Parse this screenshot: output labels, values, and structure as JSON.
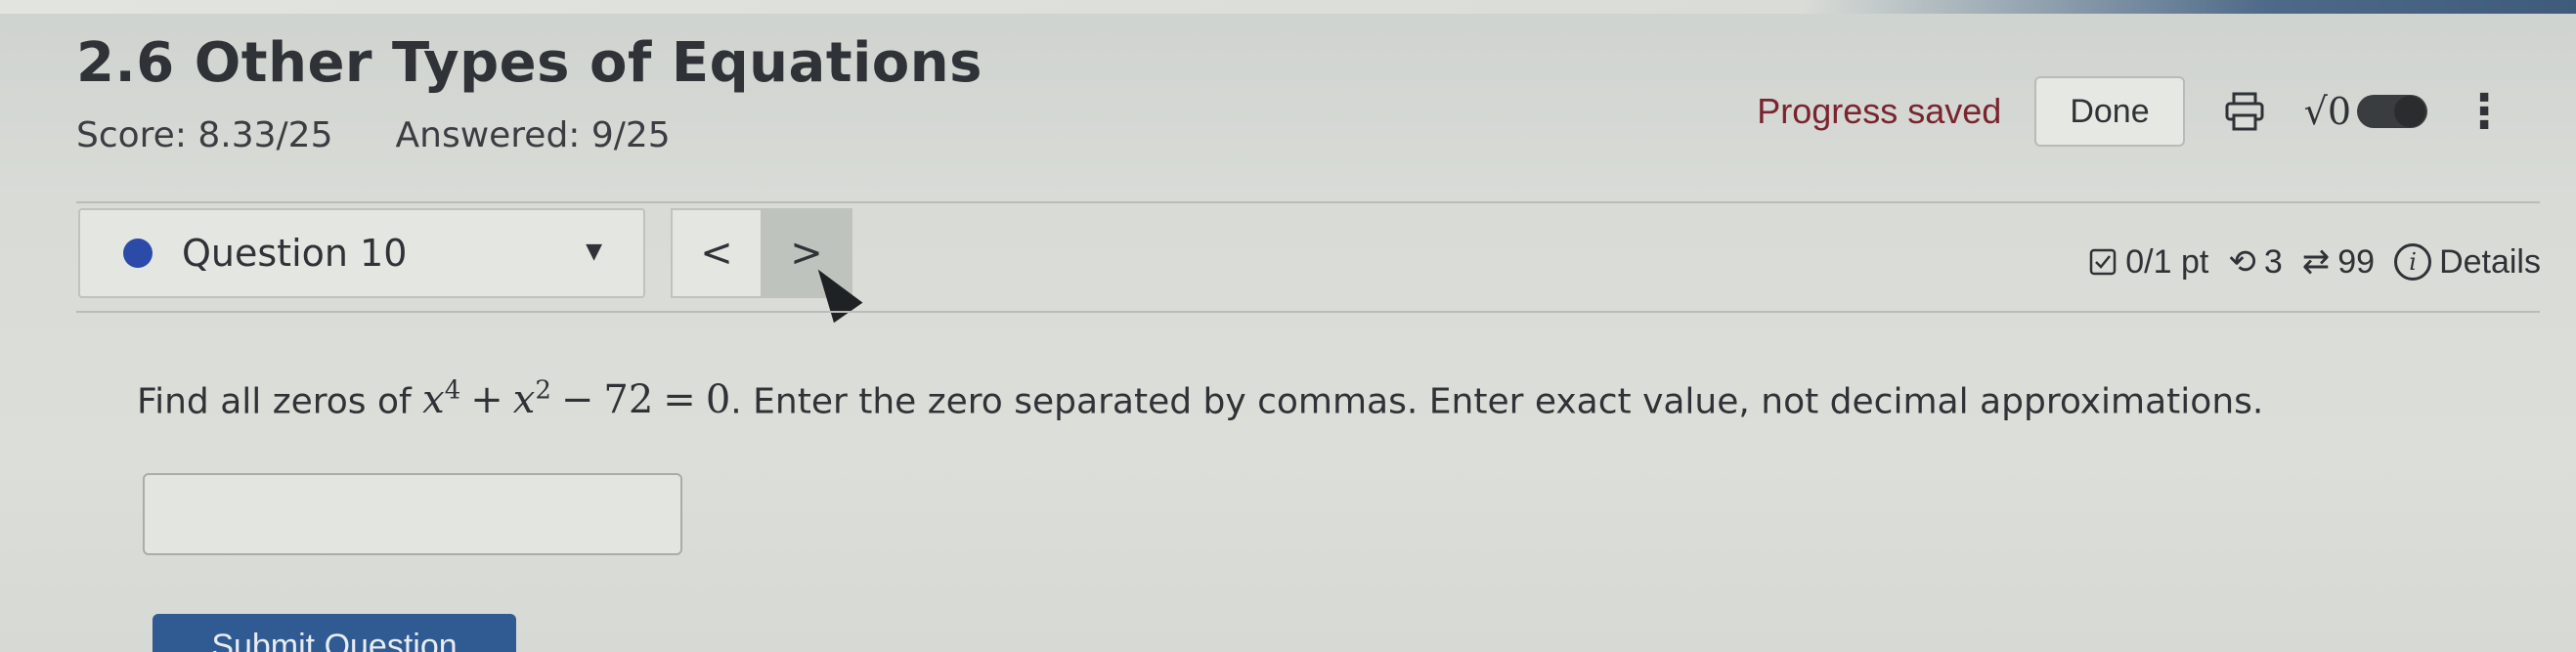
{
  "header": {
    "title": "2.6 Other Types of Equations",
    "score_label": "Score: 8.33/25",
    "answered_label": "Answered: 9/25",
    "progress_text": "Progress saved",
    "done_label": "Done",
    "print_icon": "printer-icon",
    "math_icon": "square-root-icon",
    "math_icon_glyph": "√0",
    "menu_icon": "kebab-menu-icon"
  },
  "question_nav": {
    "selected": "Question 10",
    "prev_glyph": "<",
    "next_glyph": ">"
  },
  "question_meta": {
    "points": "0/1 pt",
    "retries": "3",
    "attempts": "99",
    "details_label": "Details"
  },
  "problem": {
    "prefix": "Find all zeros of ",
    "equation_x": "x",
    "equation_exp4": "4",
    "equation_plus": "+",
    "equation_x2": "x",
    "equation_exp2": "2",
    "equation_minus": "−",
    "equation_const": "72",
    "equation_eq": "=",
    "equation_zero": "0",
    "suffix": ". Enter the zero separated by commas. Enter exact value, not decimal approximations."
  },
  "answer": {
    "value": ""
  },
  "submit_label": "Submit Question",
  "colors": {
    "accent": "#2f5b92",
    "progress_text": "#7a2430",
    "question_dot": "#2c4aa8"
  }
}
